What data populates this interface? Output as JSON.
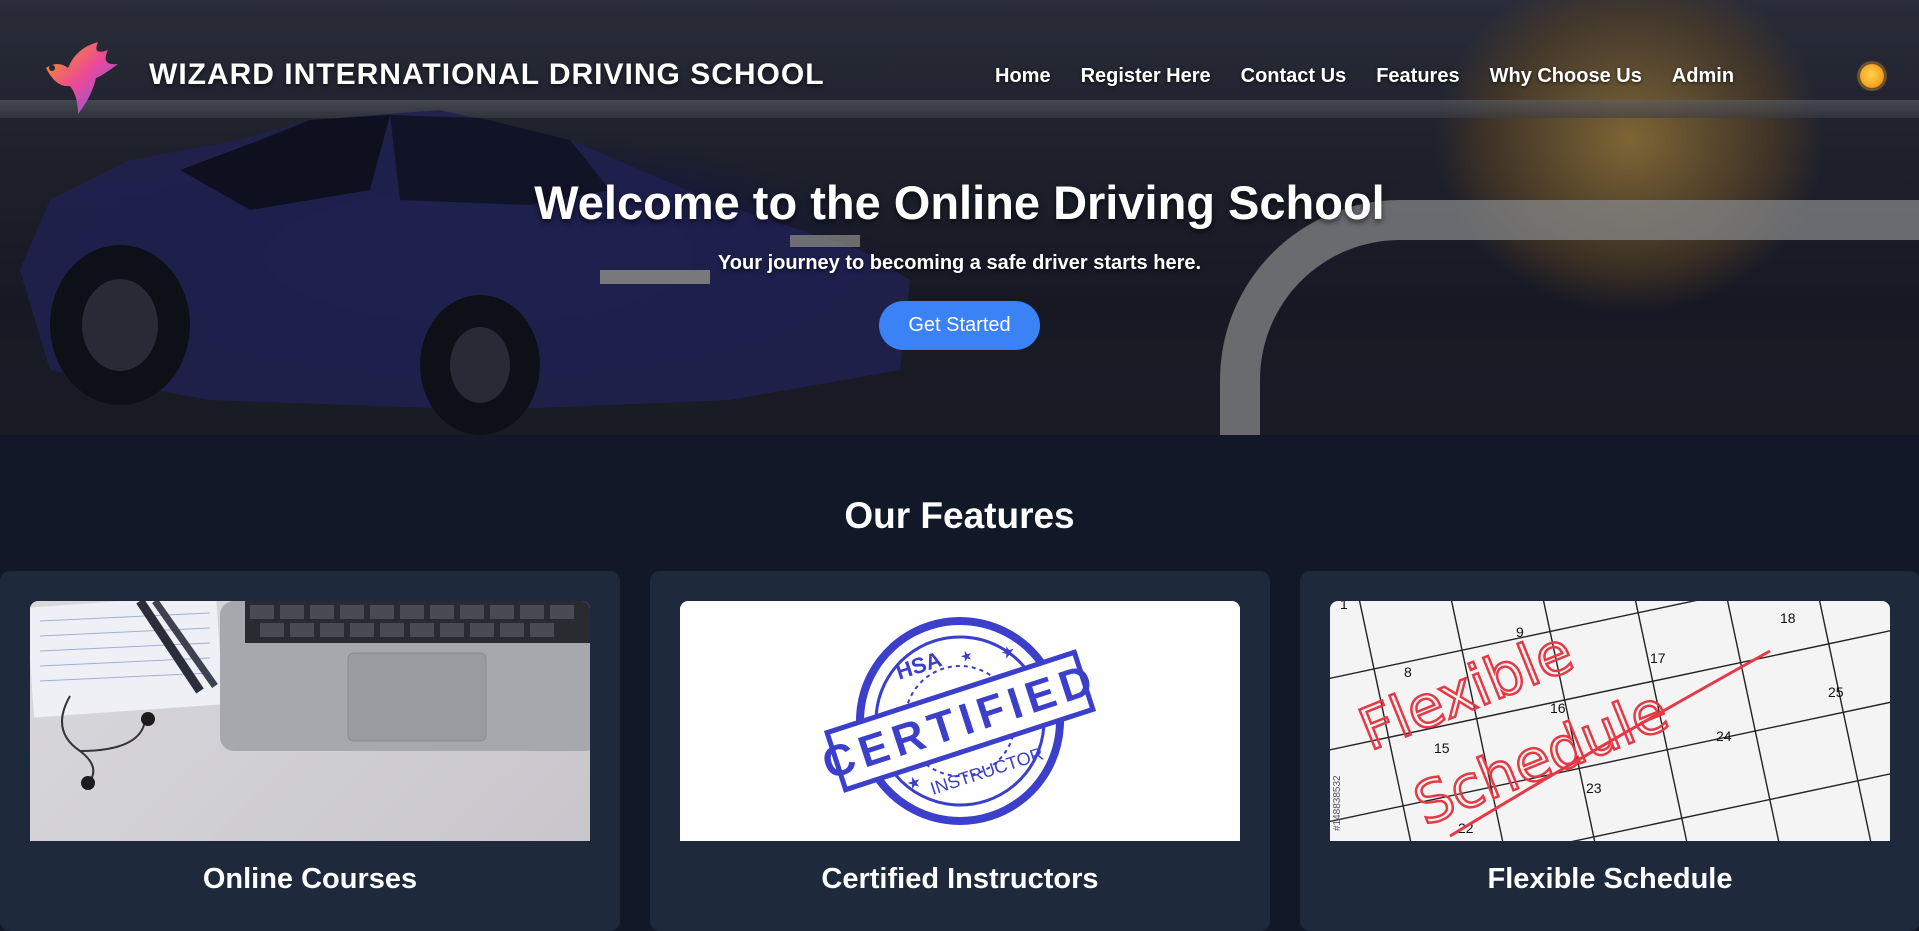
{
  "header": {
    "brand": "WIZARD INTERNATIONAL DRIVING SCHOOL",
    "menu": [
      "Home",
      "Register Here",
      "Contact Us",
      "Features",
      "Why Choose Us",
      "Admin"
    ],
    "theme_icon": "sun-icon"
  },
  "hero": {
    "title": "Welcome to the Online Driving School",
    "subtitle": "Your journey to becoming a safe driver starts here.",
    "cta_label": "Get Started"
  },
  "features": {
    "title": "Our Features",
    "cards": [
      {
        "label": "Online Courses",
        "image": "laptop-desk-photo"
      },
      {
        "label": "Certified Instructors",
        "image": "certified-stamp"
      },
      {
        "label": "Flexible Schedule",
        "image": "calendar-photo"
      }
    ],
    "stamp": {
      "top": "HSA",
      "main": "CERTIFIED",
      "bottom": "INSTRUCTOR"
    },
    "schedule_words": [
      "Flexible",
      "Schedule"
    ],
    "calendar_numbers": [
      "1",
      "8",
      "9",
      "15",
      "16",
      "17",
      "18",
      "22",
      "23",
      "24",
      "25"
    ],
    "stock_id": "#148838532"
  },
  "colors": {
    "accent": "#3b82f6",
    "page_bg": "#111827",
    "card_bg": "#1e293b",
    "stamp_blue": "#3b3fc9",
    "schedule_red": "#e53945"
  }
}
